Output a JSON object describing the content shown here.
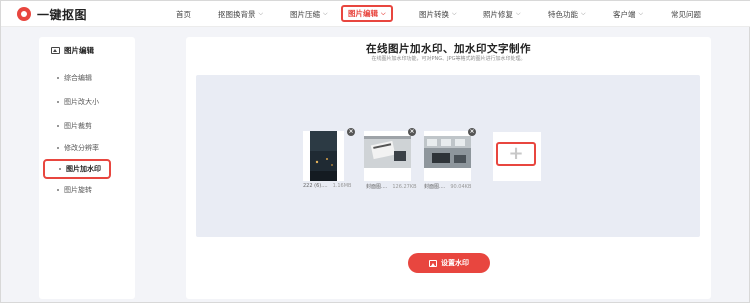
{
  "logo": {
    "text": "一键抠图"
  },
  "nav": {
    "items": [
      {
        "label": "首页",
        "chev": ""
      },
      {
        "label": "抠图换背景",
        "chev": "⌵"
      },
      {
        "label": "图片压缩",
        "chev": "⌵"
      },
      {
        "label": "图片编辑",
        "chev": "⌵"
      },
      {
        "label": "图片转换",
        "chev": "⌵"
      },
      {
        "label": "照片修复",
        "chev": "⌵"
      },
      {
        "label": "特色功能",
        "chev": "⌵"
      },
      {
        "label": "客户端",
        "chev": "⌵"
      },
      {
        "label": "常见问题",
        "chev": ""
      }
    ],
    "active": "图片编辑"
  },
  "sidebar": {
    "title": "图片编辑",
    "items": [
      {
        "label": "综合编辑"
      },
      {
        "label": "图片改大小"
      },
      {
        "label": "图片裁剪"
      },
      {
        "label": "修改分辨率"
      },
      {
        "label": "图片加水印"
      },
      {
        "label": "图片旋转"
      }
    ],
    "active": "图片加水印"
  },
  "main": {
    "title": "在线图片加水印、加水印文字制作",
    "subtitle": "在线图片加水印功能，可对PNG、JPG等格式的图片进行加水印处理。",
    "thumbnails": [
      {
        "name": "222 (6)....",
        "size": "1.16MB",
        "close": "×",
        "icon": "dark-street-photo"
      },
      {
        "name": "封面图....",
        "size": "126.27KB",
        "close": "×",
        "icon": "desk-photo"
      },
      {
        "name": "封面图....",
        "size": "90.04KB",
        "close": "×",
        "icon": "office-photo"
      }
    ],
    "add_symbol": "+",
    "watermark_button": {
      "label": "设置水印",
      "icon": "image-icon"
    }
  },
  "colors": {
    "accent": "#e8463f",
    "panel_bg": "#e9ecf4",
    "page_bg": "#f3f4f8"
  }
}
